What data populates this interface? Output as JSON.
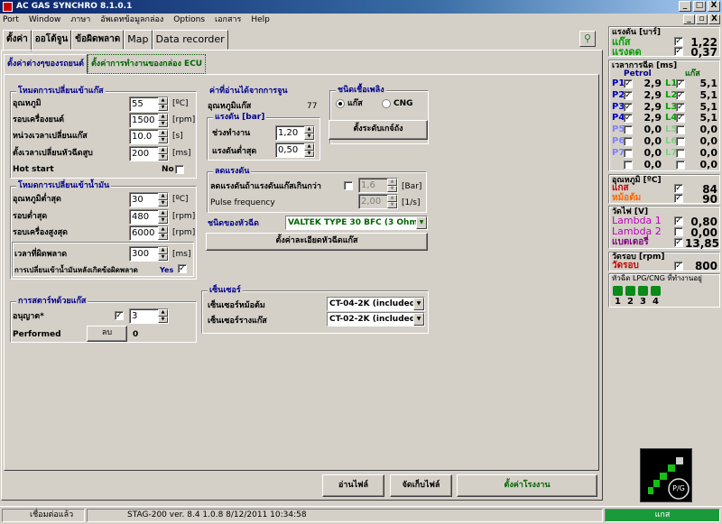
{
  "window": {
    "title": "AC GAS SYNCHRO  8.1.0.1",
    "controls": [
      "_",
      "□",
      "X"
    ],
    "mdi_controls": [
      "_",
      "▫",
      "X"
    ]
  },
  "menu": [
    "Port",
    "Window",
    "ภาษา",
    "อัพเดทข้อมูลกล่อง",
    "Options",
    "เอกสาร",
    "Help"
  ],
  "tabs": [
    "ตั้งค่า",
    "ออโต้จูน",
    "ข้อผิดพลาด",
    "Map",
    "Data recorder"
  ],
  "subtabs": [
    "ตั้งค่าต่างๆของรถยนต์",
    "ตั้งค่าการทำงานของกล่อง ECU"
  ],
  "switch_gas": {
    "title": "โหมดการเปลี่ยนเข้าแก๊ส",
    "rows": [
      {
        "label": "อุณหภูมิ",
        "value": "55",
        "unit": "[ºC]"
      },
      {
        "label": "รอบเครื่องยนต์",
        "value": "1500",
        "unit": "[rpm]"
      },
      {
        "label": "หน่วงเวลาเปลี่ยนแก๊ส",
        "value": "10.0",
        "unit": "[s]"
      },
      {
        "label": "ตั้งเวลาเปลี่ยนหัวฉีดสูบ",
        "value": "200",
        "unit": "[ms]"
      }
    ],
    "hot_start": "Hot start",
    "hot_start_value": "No"
  },
  "switch_petrol": {
    "title": "โหมดการเปลี่ยนเข้าน้ำมัน",
    "rows": [
      {
        "label": "อุณหภูมิต่ำสุด",
        "value": "30",
        "unit": "[ºC]"
      },
      {
        "label": "รอบต่ำสุด",
        "value": "480",
        "unit": "[rpm]"
      },
      {
        "label": "รอบเครื่องสูงสุด",
        "value": "6000",
        "unit": "[rpm]"
      }
    ],
    "fault_time": "เวลาที่ผิดพลาด",
    "fault_value": "300",
    "fault_unit": "[ms]",
    "fault_switch": "การเปลี่ยนเข้าน้ำมันหลังเกิดข้อผิดพลาด",
    "fault_switch_value": "Yes"
  },
  "start_gas": {
    "title": "การสตาร์ทด้วยแก๊ส",
    "allow": "อนุญาต*",
    "allow_value": "3",
    "performed": "Performed",
    "performed_btn": "ลบ",
    "performed_value": "0"
  },
  "reducer": {
    "title": "ค่าที่อ่านได้จากการจูน",
    "temp_label": "อุณหภูมิแก๊ส",
    "temp_value": "77",
    "pressure": {
      "title": "แรงดัน [bar]",
      "rows": [
        {
          "label": "ช่วงทำงาน",
          "value": "1,20"
        },
        {
          "label": "แรงดันต่ำสุด",
          "value": "0,50"
        }
      ]
    }
  },
  "fuel_type": {
    "title": "ชนิดเชื้อเพลิง",
    "options": [
      "แก๊ส",
      "CNG"
    ],
    "level_button": "ตั้งระดับเกจ์ถัง"
  },
  "pressure_red": {
    "title": "ลดแรงดัน",
    "row1": "ลดแรงดันถ้าแรงดันแก๊สเกินกว่า",
    "row1_value": "1,6",
    "row1_unit": "[Bar]",
    "row2": "Pulse frequency",
    "row2_value": "2,00",
    "row2_unit": "[1/s]"
  },
  "injector": {
    "label": "ชนิดของหัวฉีด",
    "value": "VALTEK TYPE 30 BFC (3 Ohm)",
    "detail_button": "ตั้งค่าละเอียดหัวฉีดแก๊ส"
  },
  "sensors": {
    "title": "เซ็นเซอร์",
    "rows": [
      {
        "label": "เซ็นเซอร์หม้อต้ม",
        "value": "CT-04-2K (included in"
      },
      {
        "label": "เซ็นเซอร์รางแก๊ส",
        "value": "CT-02-2K (included in"
      }
    ]
  },
  "bottom_buttons": [
    "อ่านไฟล์",
    "จัดเก็บไฟล์",
    "ตั้งค่าโรงงาน"
  ],
  "right": {
    "pressure": {
      "title": "แรงดัน [บาร์]",
      "rows": [
        {
          "label": "แก๊ส",
          "value": "1,22",
          "color": "#00a000"
        },
        {
          "label": "แรงดด",
          "value": "0,37",
          "color": "#00a000"
        }
      ]
    },
    "inj_time": {
      "title": "เวลาการฉีด [ms]",
      "col_petrol": "Petrol",
      "col_gas": "แก๊ส",
      "rows": [
        {
          "p": "P1",
          "pv": "2,9",
          "l": "L1",
          "lv": "5,1",
          "on": true
        },
        {
          "p": "P2",
          "pv": "2,9",
          "l": "L2",
          "lv": "5,1",
          "on": true
        },
        {
          "p": "P3",
          "pv": "2,9",
          "l": "L3",
          "lv": "5,1",
          "on": true
        },
        {
          "p": "P4",
          "pv": "2,9",
          "l": "L4",
          "lv": "5,1",
          "on": true
        },
        {
          "p": "P5",
          "pv": "0,0",
          "l": "L5",
          "lv": "0,0",
          "on": false
        },
        {
          "p": "P6",
          "pv": "0,0",
          "l": "L6",
          "lv": "0,0",
          "on": false
        },
        {
          "p": "P7",
          "pv": "0,0",
          "l": "L7",
          "lv": "0,0",
          "on": false
        },
        {
          "p": "",
          "pv": "0,0",
          "l": "",
          "lv": "0,0",
          "on": false
        }
      ]
    },
    "temp": {
      "title": "อุณหภูมิ [ºC]",
      "rows": [
        {
          "label": "แกส",
          "value": "84",
          "color": "#c00000"
        },
        {
          "label": "หม้อต้ม",
          "value": "90",
          "color": "#ff6600"
        }
      ]
    },
    "volt": {
      "title": "วัดไฟ [V]",
      "rows": [
        {
          "label": "Lambda 1",
          "value": "0,80",
          "color": "#c000c0"
        },
        {
          "label": "Lambda 2",
          "value": "0,00",
          "color": "#c000c0"
        },
        {
          "label": "แบตเตอรี่",
          "value": "13,85",
          "color": "#800080"
        }
      ]
    },
    "rpm": {
      "title": "วัดรอบ [rpm]",
      "label": "วัดรอบ",
      "value": "800",
      "color": "#c00000"
    },
    "injectors": {
      "title": "หัวฉีด LPG/CNG ที่ทำงานอยู่",
      "numbers": [
        "1",
        "2",
        "3",
        "4"
      ]
    },
    "gauge": "P/G"
  },
  "status": {
    "connection": "เชื่อมต่อแล้ว",
    "version": "STAG-200   ver. 8.4  1.0.8    8/12/2011 10:34:58",
    "mode": "แกส"
  }
}
